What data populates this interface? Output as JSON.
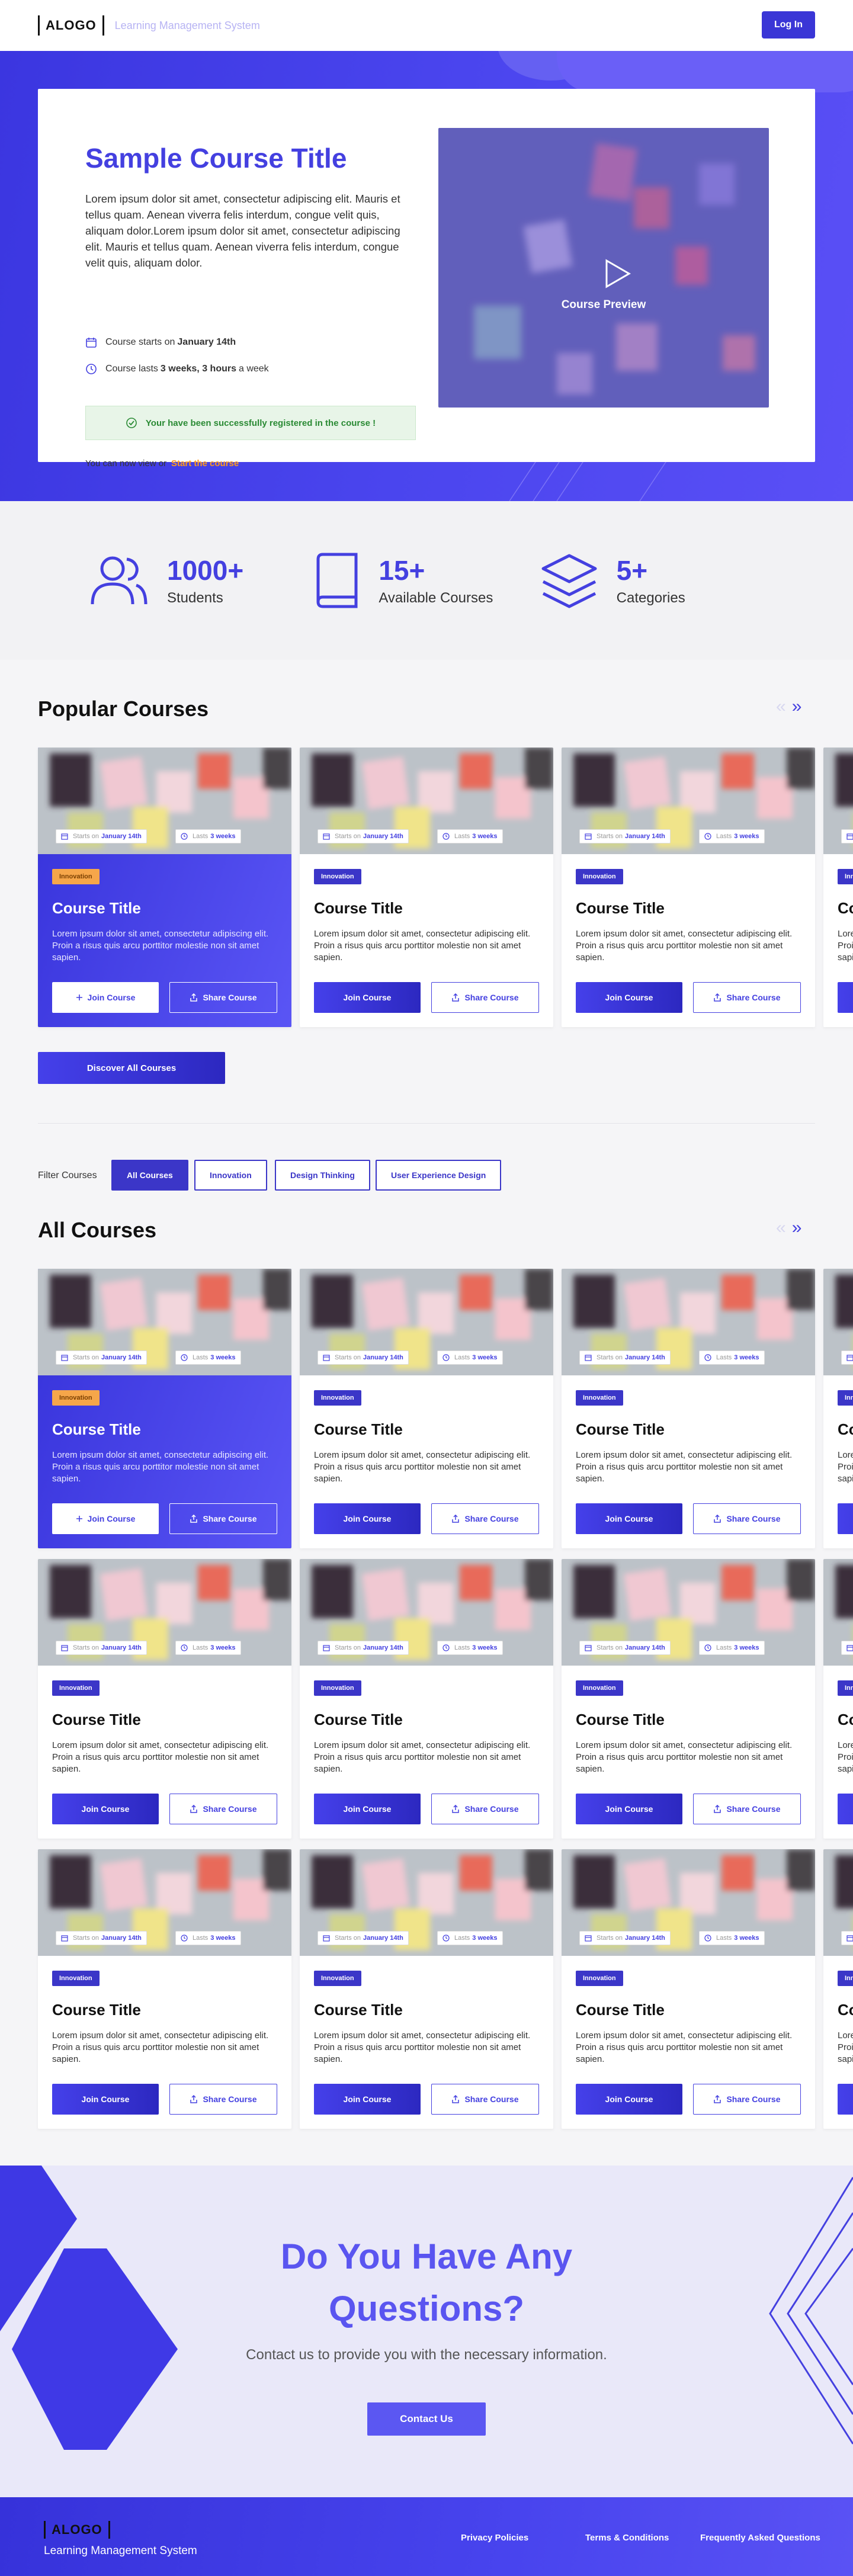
{
  "header": {
    "logo": "ALOGO",
    "subtitle": "Learning Management System",
    "login": "Log In"
  },
  "hero": {
    "title": "Sample Course Title",
    "description": "Lorem ipsum dolor sit amet, consectetur adipiscing elit. Mauris et tellus quam. Aenean viverra felis interdum, congue velit quis, aliquam dolor.Lorem ipsum dolor sit amet, consectetur adipiscing elit. Mauris et tellus quam. Aenean viverra felis interdum, congue velit quis, aliquam dolor.",
    "starts_prefix": "Course starts on ",
    "starts_date": "January 14th",
    "lasts_prefix": "Course lasts ",
    "lasts_value": "3 weeks, 3 hours",
    "lasts_suffix": " a week",
    "success": "Your have been successfully registered in the course !",
    "view_prefix": "You can now view or",
    "start_link": "Start the course",
    "preview_label": "Course Preview"
  },
  "stats": [
    {
      "icon": "users-icon",
      "value": "1000+",
      "label": "Students"
    },
    {
      "icon": "book-icon",
      "value": "15+",
      "label": "Available Courses"
    },
    {
      "icon": "layers-icon",
      "value": "5+",
      "label": "Categories"
    }
  ],
  "popular": {
    "title": "Popular Courses",
    "discover": "Discover All Courses"
  },
  "card": {
    "starts_label": "Starts on",
    "starts_date": "January 14th",
    "lasts_label": "Lasts",
    "lasts_value": "3 weeks",
    "badge": "Innovation",
    "title": "Course Title",
    "description": "Lorem ipsum dolor sit amet, consectetur adipiscing elit. Proin a risus quis arcu porttitor molestie non sit amet sapien.",
    "join": "Join Course",
    "share": "Share Course"
  },
  "filter": {
    "label": "Filter Courses",
    "options": [
      "All Courses",
      "Innovation",
      "Design Thinking",
      "User Experience Design"
    ],
    "active": "All Courses"
  },
  "all": {
    "title": "All Courses"
  },
  "contact": {
    "title_line1": "Do You Have Any",
    "title_line2": "Questions?",
    "subtitle": "Contact us to provide you with the necessary information.",
    "button": "Contact Us"
  },
  "footer": {
    "logo": "ALOGO",
    "subtitle": "Learning Management System",
    "links": [
      "Privacy Policies",
      "Terms & Conditions",
      "Frequently Asked Questions"
    ]
  },
  "colors": {
    "primary": "#4440e0",
    "accent": "#ff9a1e",
    "success": "#2a8a34"
  }
}
